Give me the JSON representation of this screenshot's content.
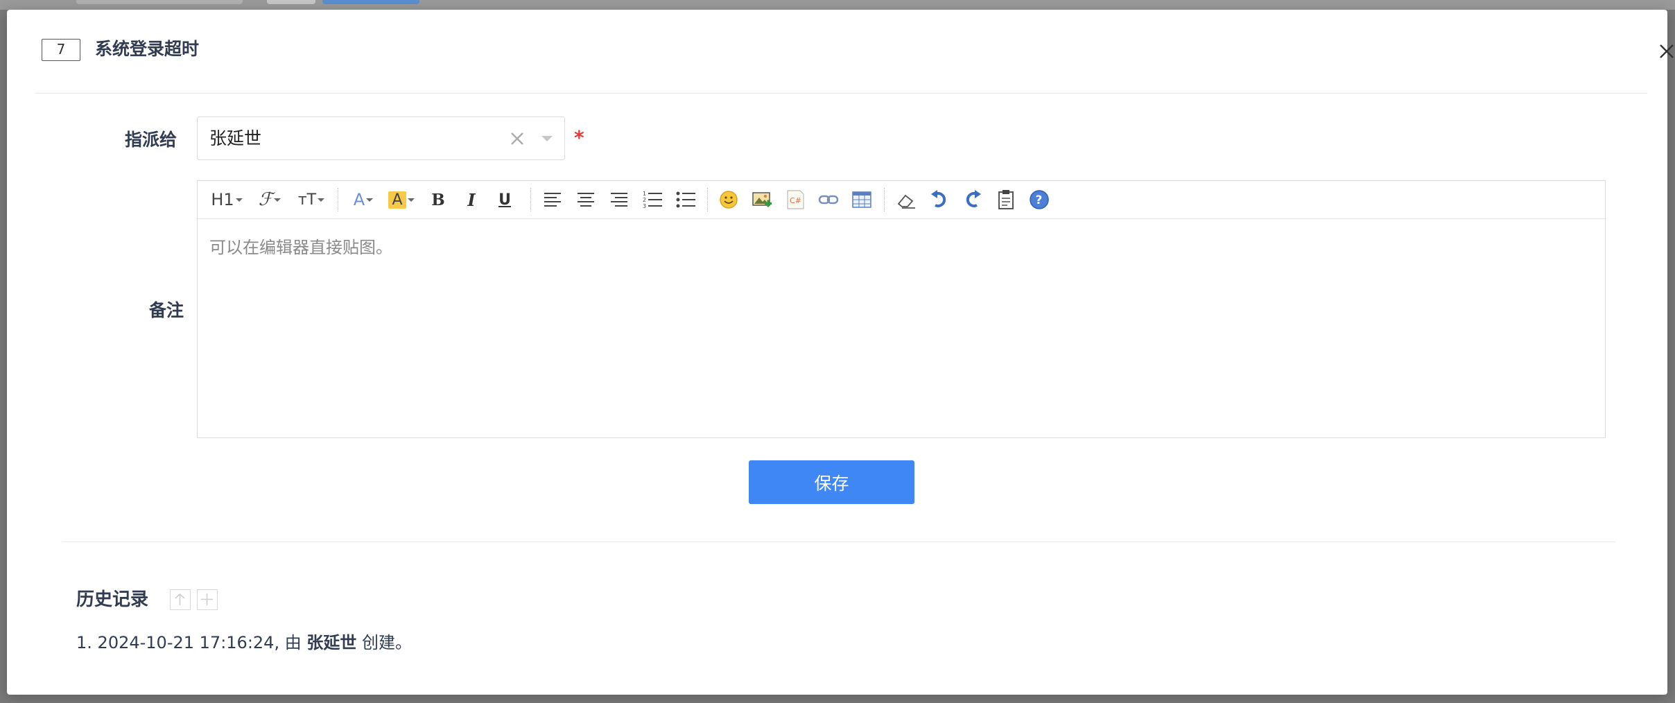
{
  "modal": {
    "id": "7",
    "title": "系统登录超时"
  },
  "form": {
    "assign_label": "指派给",
    "assign_value": "张延世",
    "required_mark": "*",
    "remark_label": "备注",
    "editor_placeholder": "可以在编辑器直接贴图。",
    "save_label": "保存"
  },
  "toolbar": {
    "heading": "H1",
    "font": "ℱ",
    "font_size": "тT",
    "font_color": "A",
    "highlight": "A",
    "bold": "B",
    "italic": "I",
    "underline": "U"
  },
  "history": {
    "title": "历史记录",
    "items": [
      {
        "index": "1.",
        "timestamp": "2024-10-21 17:16:24,",
        "by": "由",
        "user": "张延世",
        "action": "创建。"
      }
    ]
  },
  "colors": {
    "primary_button": "#3f87f5",
    "required": "#e53935",
    "highlight_yellow": "#f7c948",
    "link_blue": "#4a7bd0"
  }
}
